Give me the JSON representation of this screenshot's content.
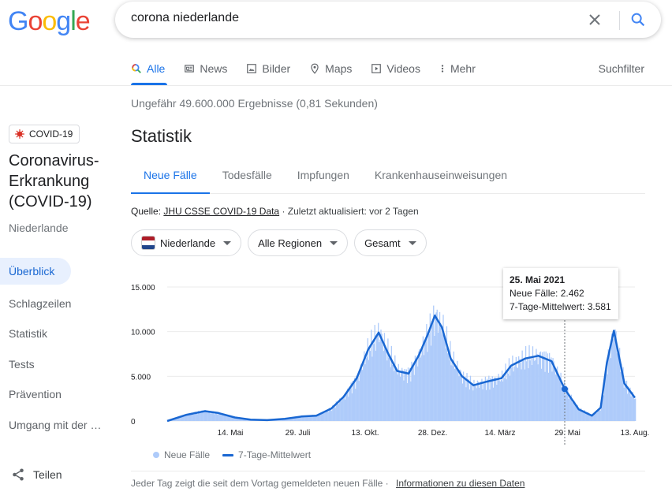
{
  "logo": {
    "text": "Google",
    "colors": [
      "#4285f4",
      "#ea4335",
      "#fbbc05",
      "#4285f4",
      "#34a853",
      "#ea4335"
    ]
  },
  "search": {
    "query": "corona niederlande"
  },
  "tabs": [
    {
      "label": "Alle",
      "icon": "search-icon",
      "active": true
    },
    {
      "label": "News",
      "icon": "news-icon"
    },
    {
      "label": "Bilder",
      "icon": "image-icon"
    },
    {
      "label": "Maps",
      "icon": "map-pin-icon"
    },
    {
      "label": "Videos",
      "icon": "video-icon"
    },
    {
      "label": "Mehr",
      "icon": "more-vert-icon"
    }
  ],
  "tools_label": "Suchfilter",
  "result_stats": "Ungefähr 49.600.000 Ergebnisse (0,81 Sekunden)",
  "sidebar": {
    "badge": "COVID-19",
    "title": "Coronavirus-Erkrankung (COVID-19)",
    "region": "Niederlande",
    "items": [
      {
        "label": "Überblick",
        "active": true
      },
      {
        "label": "Schlagzeilen"
      },
      {
        "label": "Statistik"
      },
      {
        "label": "Tests"
      },
      {
        "label": "Prävention"
      },
      {
        "label": "Umgang mit der …"
      }
    ],
    "share": "Teilen"
  },
  "stats": {
    "title": "Statistik",
    "tabs": [
      "Neue Fälle",
      "Todesfälle",
      "Impfungen",
      "Krankenhauseinweisungen"
    ],
    "active_tab": 0,
    "source_prefix": "Quelle:",
    "source_link": "JHU CSSE COVID-19 Data",
    "updated": "· Zuletzt aktualisiert: vor 2 Tagen",
    "filters": [
      "Niederlande",
      "Alle Regionen",
      "Gesamt"
    ],
    "tooltip": {
      "date": "25. Mai 2021",
      "line1": "Neue Fälle: 2.462",
      "line2": "7-Tage-Mittelwert: 3.581"
    },
    "legend": [
      "Neue Fälle",
      "7-Tage-Mittelwert"
    ],
    "footnote": "Jeder Tag zeigt die seit dem Vortag gemeldeten neuen Fälle",
    "footnote_link": "Informationen zu diesen Daten"
  },
  "chart_data": {
    "type": "area",
    "colors": {
      "bars": "#aecbfa",
      "line": "#1967d2"
    },
    "y_ticks": [
      "15.000",
      "10.000",
      "5.000",
      "0"
    ],
    "x_ticks": [
      "14. Mai",
      "29. Juli",
      "13. Okt.",
      "28. Dez.",
      "14. März",
      "29. Mai",
      "13. Aug."
    ],
    "ylim": [
      0,
      15000
    ],
    "grid": true,
    "legend_position": "bottom",
    "series": [
      {
        "name": "7-Tage-Mittelwert",
        "x": [
          "2020-02-27",
          "2020-03-20",
          "2020-04-10",
          "2020-04-25",
          "2020-05-14",
          "2020-06-01",
          "2020-06-20",
          "2020-07-10",
          "2020-07-29",
          "2020-08-15",
          "2020-09-01",
          "2020-09-15",
          "2020-09-30",
          "2020-10-13",
          "2020-10-25",
          "2020-11-05",
          "2020-11-15",
          "2020-11-28",
          "2020-12-10",
          "2020-12-20",
          "2020-12-28",
          "2021-01-05",
          "2021-01-15",
          "2021-01-28",
          "2021-02-10",
          "2021-02-25",
          "2021-03-14",
          "2021-03-25",
          "2021-04-10",
          "2021-04-25",
          "2021-05-10",
          "2021-05-25",
          "2021-06-10",
          "2021-06-25",
          "2021-07-05",
          "2021-07-12",
          "2021-07-20",
          "2021-08-01",
          "2021-08-13"
        ],
        "y": [
          0,
          700,
          1100,
          900,
          400,
          150,
          100,
          250,
          500,
          600,
          1400,
          2700,
          4800,
          8000,
          9900,
          7500,
          5600,
          5300,
          7400,
          9700,
          11800,
          10500,
          7000,
          5000,
          4000,
          4400,
          4800,
          6200,
          7000,
          7300,
          6700,
          3581,
          1300,
          600,
          1500,
          6500,
          10100,
          4200,
          2600
        ]
      },
      {
        "name": "Neue Fälle",
        "x": [
          "2021-05-25"
        ],
        "y": [
          2462
        ]
      }
    ]
  }
}
